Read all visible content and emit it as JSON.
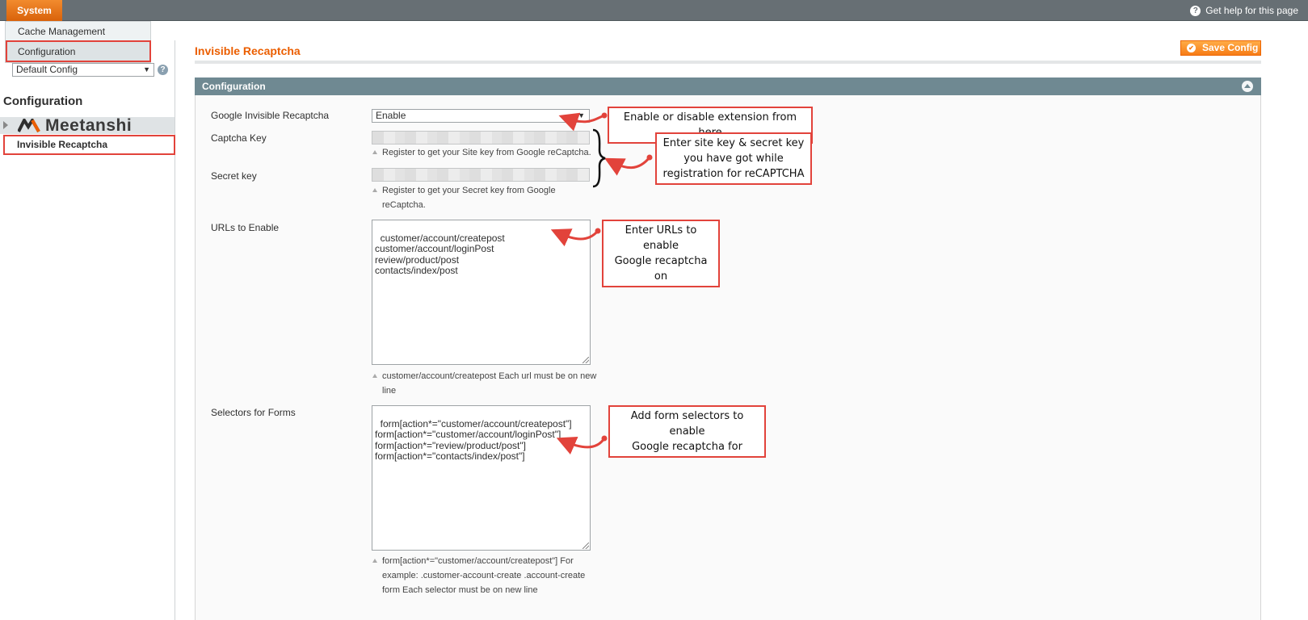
{
  "topbar": {
    "system_label": "System",
    "help_label": "Get help for this page",
    "help_icon": "question-circle-icon"
  },
  "system_menu": {
    "items": [
      {
        "label": "Cache Management"
      },
      {
        "label": "Configuration"
      }
    ]
  },
  "sidebar": {
    "scope_value": "Default Config",
    "title": "Configuration",
    "brand": "Meetanshi",
    "items": [
      {
        "label": "Invisible Recaptcha"
      }
    ]
  },
  "page": {
    "title": "Invisible Recaptcha",
    "save_label": "Save Config"
  },
  "section": {
    "title": "Configuration",
    "fields": {
      "enable": {
        "label": "Google Invisible Recaptcha",
        "value": "Enable"
      },
      "captcha_key": {
        "label": "Captcha Key",
        "note": "Register to get your Site key from Google reCaptcha."
      },
      "secret_key": {
        "label": "Secret key",
        "note_line1": "Register to get your Secret key from Google",
        "note_line2": "reCaptcha."
      },
      "urls": {
        "label": "URLs to Enable",
        "value": "customer/account/createpost\ncustomer/account/loginPost\nreview/product/post\ncontacts/index/post",
        "note_line1": "customer/account/createpost Each url must be on new",
        "note_line2": "line"
      },
      "selectors": {
        "label": "Selectors for Forms",
        "value": "form[action*=\"customer/account/createpost\"]\nform[action*=\"customer/account/loginPost\"]\nform[action*=\"review/product/post\"]\nform[action*=\"contacts/index/post\"]",
        "note_line1": "form[action*=\"customer/account/createpost\"] For",
        "note_line2": "example: .customer-account-create .account-create",
        "note_line3": "form Each selector must be on new line"
      }
    }
  },
  "annotations": {
    "enable_note": "Enable or disable extension from here",
    "keys_note_1": "Enter site key & secret key",
    "keys_note_2": "you have got while",
    "keys_note_3": "registration for reCAPTCHA",
    "urls_note_1": "Enter URLs to enable",
    "urls_note_2": "Google recaptcha on",
    "selectors_note_1": "Add form selectors to enable",
    "selectors_note_2": "Google recaptcha for",
    "color": "#e2433b"
  },
  "colors": {
    "accent_orange": "#eb5e00",
    "topbar": "#676f74",
    "section_header": "#6f8992"
  }
}
